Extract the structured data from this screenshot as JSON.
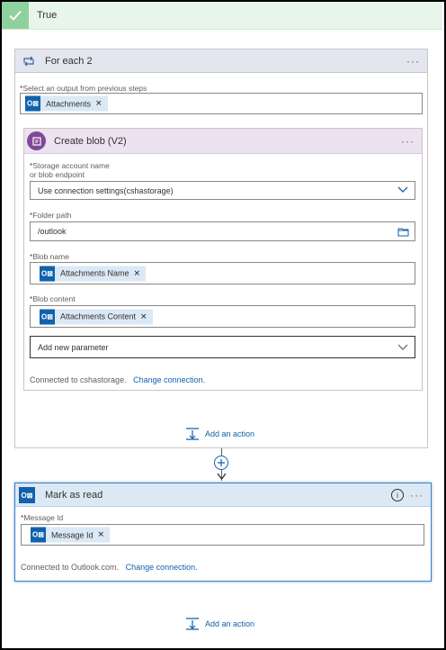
{
  "branch": {
    "title": "True"
  },
  "foreach": {
    "title": "For each 2",
    "more": "···",
    "select_label": "Select an output from previous steps",
    "select_token": "Attachments"
  },
  "create_blob": {
    "title": "Create blob (V2)",
    "more": "···",
    "storage_label_1": "Storage account name",
    "storage_label_2": "or blob endpoint",
    "storage_value": "Use connection settings(cshastorage)",
    "folder_label": "Folder path",
    "folder_value": "/outlook",
    "blob_name_label": "Blob name",
    "blob_name_token": "Attachments Name",
    "blob_content_label": "Blob content",
    "blob_content_token": "Attachments Content",
    "add_param": "Add new parameter",
    "connected_text": "Connected to cshastorage.",
    "change_connection": "Change connection."
  },
  "inner_add_action": "Add an action",
  "mark_read": {
    "title": "Mark as read",
    "more": "···",
    "message_label": "Message Id",
    "message_token": "Message Id",
    "connected_text": "Connected to Outlook.com.",
    "change_connection": "Change connection."
  },
  "outer_add_action": "Add an action",
  "colors": {
    "accent": "#0f62ae",
    "true_header": "#e8f6ea",
    "foreach_header": "#e3e6ee",
    "blob_header": "#ece3f0",
    "blob_icon": "#804998",
    "outlook_icon": "#0f62ae",
    "mark_header": "#dce9f5"
  },
  "icons": {
    "branch": "check-icon",
    "foreach": "loop-icon",
    "blob": "blob-storage-icon",
    "outlook": "outlook-icon",
    "info": "info-icon",
    "add": "add-action-icon",
    "plus": "plus-circle-icon",
    "arrow": "arrow-down-icon",
    "dropdown": "chevron-down-icon",
    "folder": "folder-icon"
  }
}
